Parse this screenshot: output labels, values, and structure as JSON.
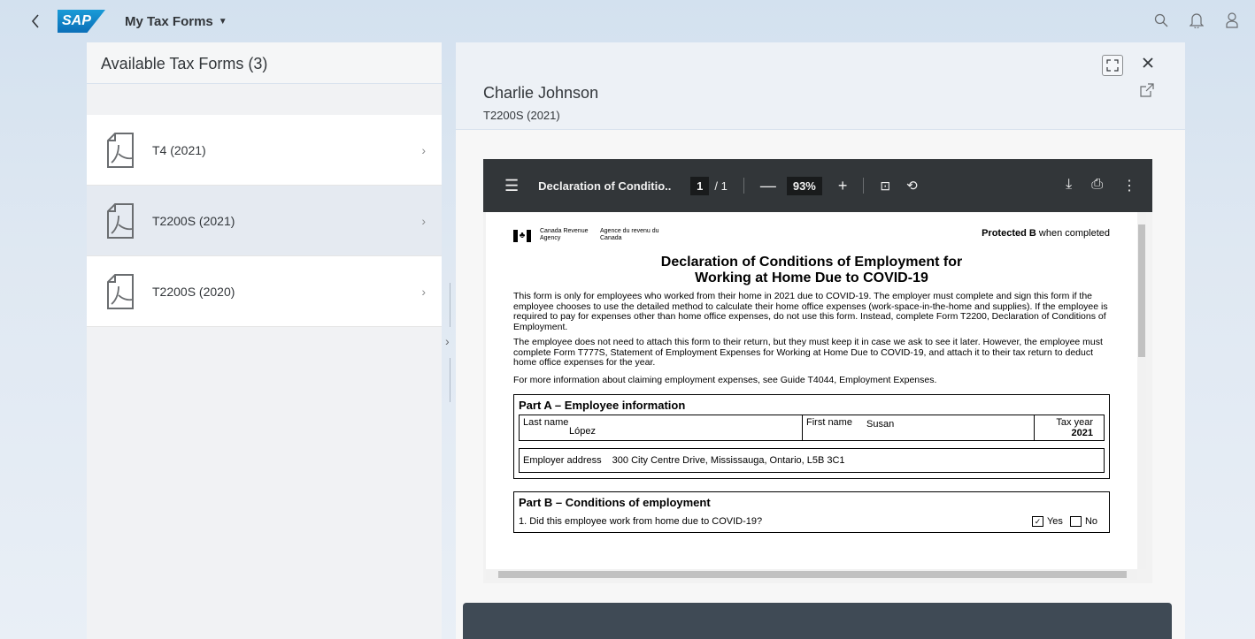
{
  "shell": {
    "app_title": "My Tax Forms",
    "logo_text": "SAP"
  },
  "left_panel": {
    "title": "Available Tax Forms (3)",
    "items": [
      {
        "label": "T4 (2021)"
      },
      {
        "label": "T2200S (2021)"
      },
      {
        "label": "T2200S (2020)"
      }
    ]
  },
  "detail": {
    "person": "Charlie Johnson",
    "form_subtitle": "T2200S (2021)"
  },
  "pdf_toolbar": {
    "doc_title": "Declaration of Conditio...",
    "current_page": "1",
    "page_total": "/  1",
    "zoom": "93%"
  },
  "form": {
    "agency_en": "Canada Revenue Agency",
    "agency_fr": "Agence du revenu du Canada",
    "protected_bold": "Protected B",
    "protected_rest": " when completed",
    "title_line1": "Declaration of Conditions of Employment for",
    "title_line2": "Working at Home Due to COVID-19",
    "para1": "This form is only for employees who worked from their home in 2021 due to COVID-19. The employer must complete and sign this form if the employee chooses to use the detailed method to calculate their home office expenses (work-space-in-the-home and supplies). If the employee is required to pay for expenses other than home office expenses, do not use this form. Instead, complete Form T2200, Declaration of Conditions of Employment.",
    "para2": "The employee does not need to attach this form to their return, but they must keep it in case we ask to see it later. However, the employee must complete Form T777S, Statement of Employment Expenses for Working at Home Due to COVID-19, and attach it to their tax return to deduct home office expenses for the year.",
    "para3": "For more information about claiming employment expenses, see Guide T4044, Employment Expenses.",
    "part_a": "Part A – Employee information",
    "last_name_label": "Last name",
    "last_name": "López",
    "first_name_label": "First name",
    "first_name": "Susan",
    "tax_year_label": "Tax year",
    "tax_year": "2021",
    "employer_address_label": "Employer address",
    "employer_address": "300 City Centre Drive, Mississauga, Ontario, L5B 3C1",
    "part_b": "Part B – Conditions of employment",
    "q1": "1. Did this employee work from home due to COVID-19?",
    "yes_label": "Yes",
    "no_label": "No",
    "q1_answer": "yes"
  },
  "colors": {
    "sap_blue": "#0b6fb8",
    "pdf_toolbar": "#323639",
    "selected_row": "#e5eaf1",
    "bottom_bar": "#3f4a55",
    "canada_red": "#000000"
  }
}
